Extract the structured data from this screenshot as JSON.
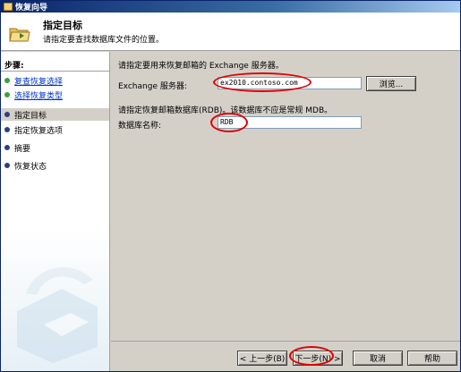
{
  "window": {
    "title": "恢复向导"
  },
  "header": {
    "title": "指定目标",
    "subtitle": "请指定要查找数据库文件的位置。"
  },
  "sidebar": {
    "title": "步骤:",
    "steps": [
      {
        "label": "复查恢复选择",
        "state": "done"
      },
      {
        "label": "选择恢复类型",
        "state": "done"
      },
      {
        "label": "指定目标",
        "state": "active"
      },
      {
        "label": "指定恢复选项",
        "state": "pending"
      },
      {
        "label": "摘要",
        "state": "pending"
      },
      {
        "label": "恢复状态",
        "state": "pending"
      }
    ]
  },
  "main": {
    "server_prompt": "请指定要用来恢复邮箱的 Exchange 服务器。",
    "server_label": "Exchange 服务器:",
    "server_value": "ex2010.contoso.com",
    "browse_label": "浏览...",
    "db_prompt": "请指定恢复邮箱数据库(RDB)。该数据库不应是常规 MDB。",
    "db_label": "数据库名称:",
    "db_value": "RDB"
  },
  "footer": {
    "back_label": "< 上一步(B)",
    "next_label": "下一步(N) >",
    "cancel_label": "取消",
    "help_label": "帮助"
  }
}
